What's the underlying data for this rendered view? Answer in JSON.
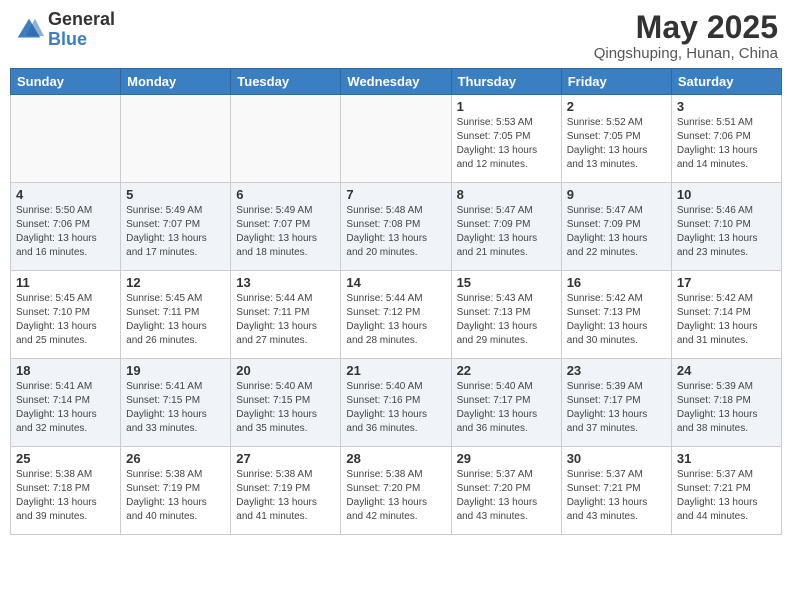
{
  "header": {
    "logo_general": "General",
    "logo_blue": "Blue",
    "month_title": "May 2025",
    "location": "Qingshuping, Hunan, China"
  },
  "weekdays": [
    "Sunday",
    "Monday",
    "Tuesday",
    "Wednesday",
    "Thursday",
    "Friday",
    "Saturday"
  ],
  "weeks": [
    [
      {
        "day": "",
        "info": ""
      },
      {
        "day": "",
        "info": ""
      },
      {
        "day": "",
        "info": ""
      },
      {
        "day": "",
        "info": ""
      },
      {
        "day": "1",
        "info": "Sunrise: 5:53 AM\nSunset: 7:05 PM\nDaylight: 13 hours\nand 12 minutes."
      },
      {
        "day": "2",
        "info": "Sunrise: 5:52 AM\nSunset: 7:05 PM\nDaylight: 13 hours\nand 13 minutes."
      },
      {
        "day": "3",
        "info": "Sunrise: 5:51 AM\nSunset: 7:06 PM\nDaylight: 13 hours\nand 14 minutes."
      }
    ],
    [
      {
        "day": "4",
        "info": "Sunrise: 5:50 AM\nSunset: 7:06 PM\nDaylight: 13 hours\nand 16 minutes."
      },
      {
        "day": "5",
        "info": "Sunrise: 5:49 AM\nSunset: 7:07 PM\nDaylight: 13 hours\nand 17 minutes."
      },
      {
        "day": "6",
        "info": "Sunrise: 5:49 AM\nSunset: 7:07 PM\nDaylight: 13 hours\nand 18 minutes."
      },
      {
        "day": "7",
        "info": "Sunrise: 5:48 AM\nSunset: 7:08 PM\nDaylight: 13 hours\nand 20 minutes."
      },
      {
        "day": "8",
        "info": "Sunrise: 5:47 AM\nSunset: 7:09 PM\nDaylight: 13 hours\nand 21 minutes."
      },
      {
        "day": "9",
        "info": "Sunrise: 5:47 AM\nSunset: 7:09 PM\nDaylight: 13 hours\nand 22 minutes."
      },
      {
        "day": "10",
        "info": "Sunrise: 5:46 AM\nSunset: 7:10 PM\nDaylight: 13 hours\nand 23 minutes."
      }
    ],
    [
      {
        "day": "11",
        "info": "Sunrise: 5:45 AM\nSunset: 7:10 PM\nDaylight: 13 hours\nand 25 minutes."
      },
      {
        "day": "12",
        "info": "Sunrise: 5:45 AM\nSunset: 7:11 PM\nDaylight: 13 hours\nand 26 minutes."
      },
      {
        "day": "13",
        "info": "Sunrise: 5:44 AM\nSunset: 7:11 PM\nDaylight: 13 hours\nand 27 minutes."
      },
      {
        "day": "14",
        "info": "Sunrise: 5:44 AM\nSunset: 7:12 PM\nDaylight: 13 hours\nand 28 minutes."
      },
      {
        "day": "15",
        "info": "Sunrise: 5:43 AM\nSunset: 7:13 PM\nDaylight: 13 hours\nand 29 minutes."
      },
      {
        "day": "16",
        "info": "Sunrise: 5:42 AM\nSunset: 7:13 PM\nDaylight: 13 hours\nand 30 minutes."
      },
      {
        "day": "17",
        "info": "Sunrise: 5:42 AM\nSunset: 7:14 PM\nDaylight: 13 hours\nand 31 minutes."
      }
    ],
    [
      {
        "day": "18",
        "info": "Sunrise: 5:41 AM\nSunset: 7:14 PM\nDaylight: 13 hours\nand 32 minutes."
      },
      {
        "day": "19",
        "info": "Sunrise: 5:41 AM\nSunset: 7:15 PM\nDaylight: 13 hours\nand 33 minutes."
      },
      {
        "day": "20",
        "info": "Sunrise: 5:40 AM\nSunset: 7:15 PM\nDaylight: 13 hours\nand 35 minutes."
      },
      {
        "day": "21",
        "info": "Sunrise: 5:40 AM\nSunset: 7:16 PM\nDaylight: 13 hours\nand 36 minutes."
      },
      {
        "day": "22",
        "info": "Sunrise: 5:40 AM\nSunset: 7:17 PM\nDaylight: 13 hours\nand 36 minutes."
      },
      {
        "day": "23",
        "info": "Sunrise: 5:39 AM\nSunset: 7:17 PM\nDaylight: 13 hours\nand 37 minutes."
      },
      {
        "day": "24",
        "info": "Sunrise: 5:39 AM\nSunset: 7:18 PM\nDaylight: 13 hours\nand 38 minutes."
      }
    ],
    [
      {
        "day": "25",
        "info": "Sunrise: 5:38 AM\nSunset: 7:18 PM\nDaylight: 13 hours\nand 39 minutes."
      },
      {
        "day": "26",
        "info": "Sunrise: 5:38 AM\nSunset: 7:19 PM\nDaylight: 13 hours\nand 40 minutes."
      },
      {
        "day": "27",
        "info": "Sunrise: 5:38 AM\nSunset: 7:19 PM\nDaylight: 13 hours\nand 41 minutes."
      },
      {
        "day": "28",
        "info": "Sunrise: 5:38 AM\nSunset: 7:20 PM\nDaylight: 13 hours\nand 42 minutes."
      },
      {
        "day": "29",
        "info": "Sunrise: 5:37 AM\nSunset: 7:20 PM\nDaylight: 13 hours\nand 43 minutes."
      },
      {
        "day": "30",
        "info": "Sunrise: 5:37 AM\nSunset: 7:21 PM\nDaylight: 13 hours\nand 43 minutes."
      },
      {
        "day": "31",
        "info": "Sunrise: 5:37 AM\nSunset: 7:21 PM\nDaylight: 13 hours\nand 44 minutes."
      }
    ]
  ]
}
